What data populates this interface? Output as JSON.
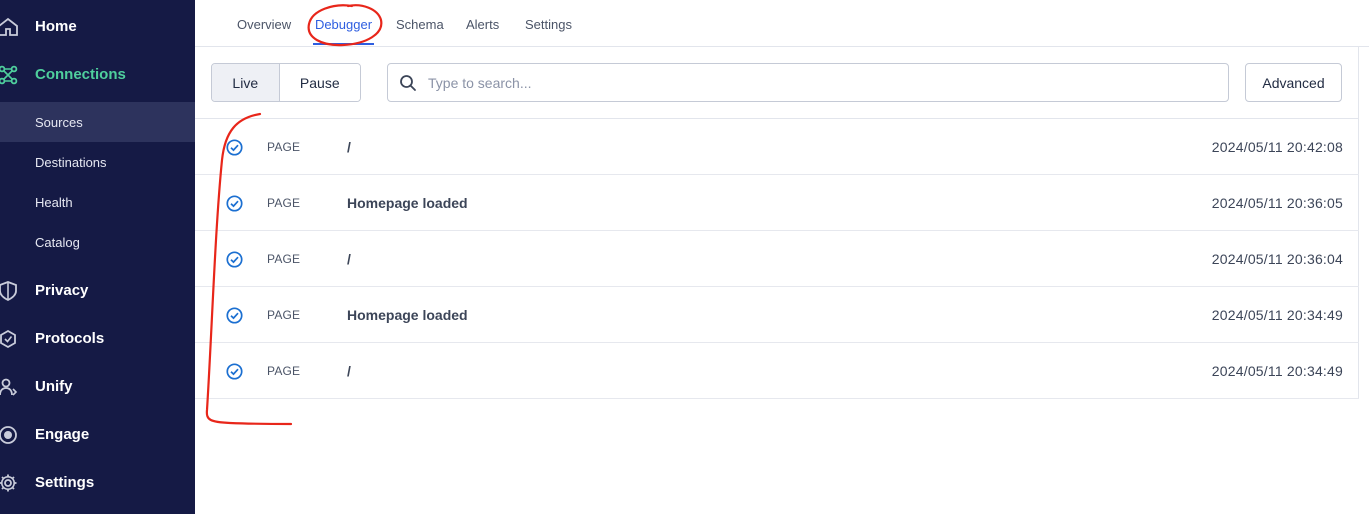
{
  "sidebar": {
    "items": [
      {
        "label": "Home",
        "icon": "home-icon"
      },
      {
        "label": "Connections",
        "icon": "connections-icon"
      },
      {
        "label": "Privacy",
        "icon": "shield-icon"
      },
      {
        "label": "Protocols",
        "icon": "protocols-icon"
      },
      {
        "label": "Unify",
        "icon": "unify-icon"
      },
      {
        "label": "Engage",
        "icon": "engage-icon"
      },
      {
        "label": "Settings",
        "icon": "gear-icon"
      }
    ],
    "subitems": [
      {
        "label": "Sources"
      },
      {
        "label": "Destinations"
      },
      {
        "label": "Health"
      },
      {
        "label": "Catalog"
      }
    ],
    "active_item": "Connections",
    "selected_subitem": "Sources"
  },
  "tabs": [
    {
      "label": "Overview"
    },
    {
      "label": "Debugger"
    },
    {
      "label": "Schema"
    },
    {
      "label": "Alerts"
    },
    {
      "label": "Settings"
    }
  ],
  "active_tab": "Debugger",
  "toolbar": {
    "live_label": "Live",
    "pause_label": "Pause",
    "search_placeholder": "Type to search...",
    "search_value": "",
    "advanced_label": "Advanced"
  },
  "events": [
    {
      "type": "PAGE",
      "name": "/",
      "time": "2024/05/11 20:42:08"
    },
    {
      "type": "PAGE",
      "name": "Homepage loaded",
      "time": "2024/05/11 20:36:05"
    },
    {
      "type": "PAGE",
      "name": "/",
      "time": "2024/05/11 20:36:04"
    },
    {
      "type": "PAGE",
      "name": "Homepage loaded",
      "time": "2024/05/11 20:34:49"
    },
    {
      "type": "PAGE",
      "name": "/",
      "time": "2024/05/11 20:34:49"
    }
  ],
  "colors": {
    "sidebar_bg": "#151a45",
    "sidebar_selected_bg": "#2d335d",
    "accent_green": "#4fcf9d",
    "accent_blue": "#2e5ee0",
    "annotation_red": "#e8261a"
  }
}
